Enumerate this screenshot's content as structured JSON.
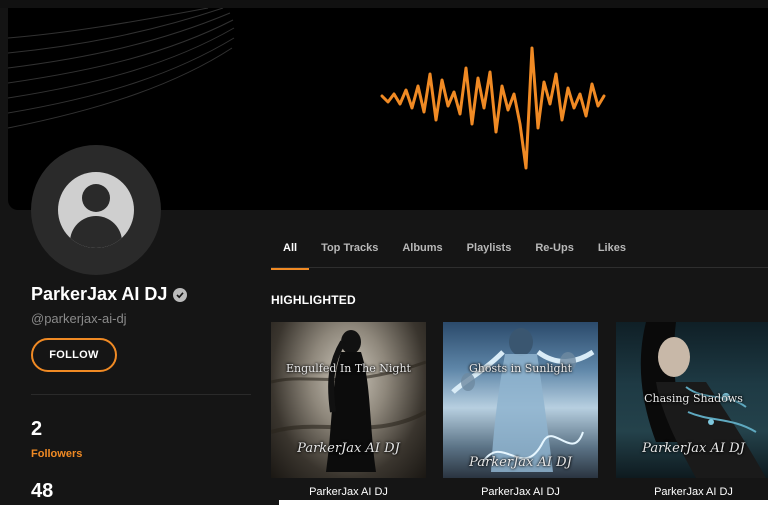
{
  "profile": {
    "name": "ParkerJax AI DJ",
    "handle": "@parkerjax-ai-dj",
    "follow_label": "FOLLOW",
    "stats": [
      {
        "value": "2",
        "label": "Followers"
      },
      {
        "value": "48",
        "label": ""
      }
    ]
  },
  "tabs": [
    {
      "label": "All",
      "active": true
    },
    {
      "label": "Top Tracks",
      "active": false
    },
    {
      "label": "Albums",
      "active": false
    },
    {
      "label": "Playlists",
      "active": false
    },
    {
      "label": "Re-Ups",
      "active": false
    },
    {
      "label": "Likes",
      "active": false
    }
  ],
  "highlighted": {
    "title": "HIGHLIGHTED",
    "items": [
      {
        "cover_title": "Engulfed In The Night",
        "cover_artist": "ParkerJax AI DJ",
        "caption": "ParkerJax AI DJ"
      },
      {
        "cover_title": "Ghosts in Sunlight",
        "cover_artist": "ParkerJax AI DJ",
        "caption": "ParkerJax AI DJ"
      },
      {
        "cover_title": "Chasing Shadows",
        "cover_artist": "ParkerJax AI DJ",
        "caption": "ParkerJax AI DJ"
      }
    ]
  },
  "colors": {
    "accent": "#f08a24",
    "background": "#141414",
    "banner": "#000000"
  },
  "icons": [
    "waveform-logo",
    "default-avatar-icon",
    "verified-check-icon"
  ]
}
